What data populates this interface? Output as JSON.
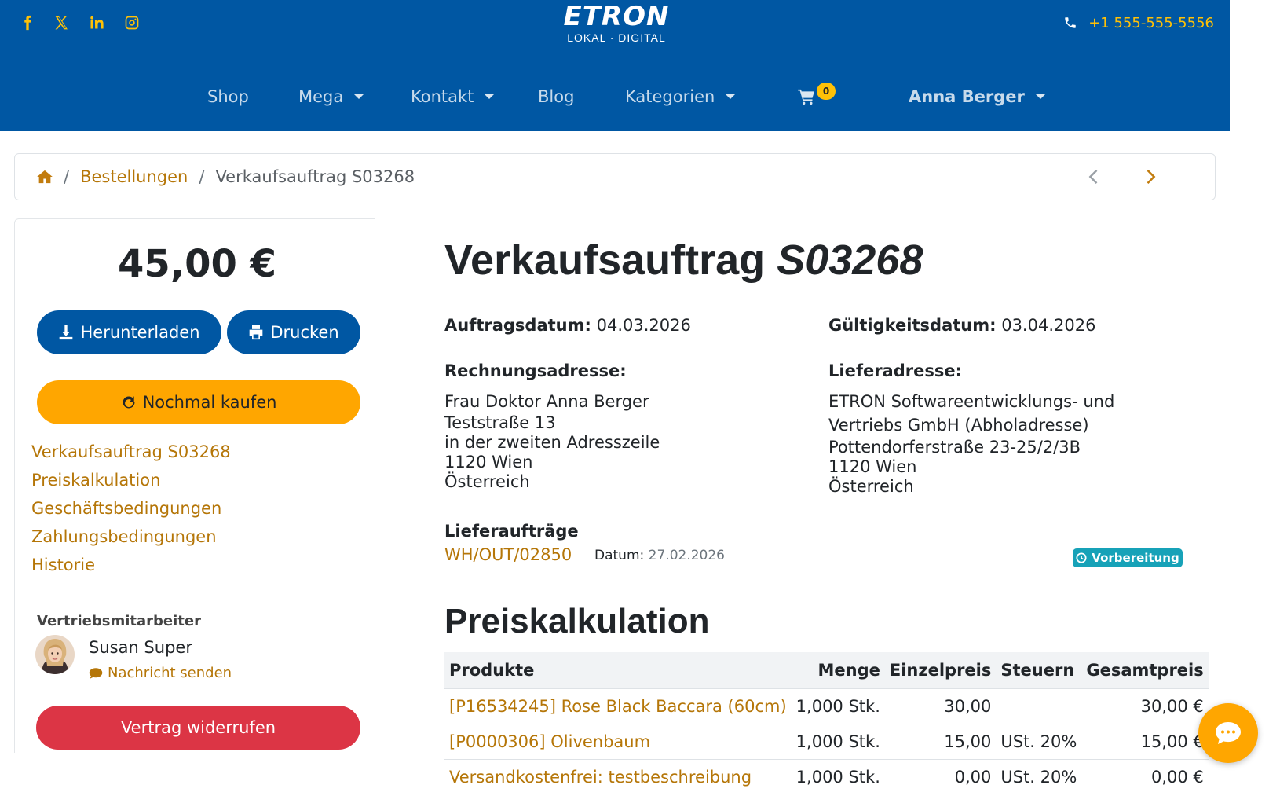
{
  "header": {
    "social": [
      {
        "icon": "facebook-icon"
      },
      {
        "icon": "x-twitter-icon"
      },
      {
        "icon": "linkedin-icon"
      },
      {
        "icon": "instagram-icon"
      }
    ],
    "logo": {
      "main": "ETRON",
      "sub": "LOKAL · DIGITAL"
    },
    "phone": "+1 555-555-5556",
    "nav": {
      "shop": "Shop",
      "mega": "Mega",
      "contact": "Kontakt",
      "blog": "Blog",
      "categories": "Kategorien",
      "cart_count": "0",
      "user": "Anna Berger"
    },
    "colors": {
      "brand": "#0057a3",
      "accent": "#ffc107"
    }
  },
  "breadcrumb": {
    "home_icon": "home-icon",
    "orders": "Bestellungen",
    "current": "Verkaufsauftrag S03268"
  },
  "sidebar": {
    "total": "45,00 €",
    "download_label": "Herunterladen",
    "print_label": "Drucken",
    "reorder_label": "Nochmal kaufen",
    "links": [
      "Verkaufsauftrag S03268",
      "Preiskalkulation",
      "Geschäftsbedingungen",
      "Zahlungsbedingungen",
      "Historie"
    ],
    "salesperson_title": "Vertriebsmitarbeiter",
    "salesperson_name": "Susan Super",
    "send_message": "Nachricht senden",
    "cancel_label": "Vertrag widerrufen"
  },
  "order": {
    "title_prefix": "Verkaufsauftrag",
    "title_ref": "S03268",
    "order_date_label": "Auftragsdatum:",
    "order_date": "04.03.2026",
    "validity_label": "Gültigkeitsdatum:",
    "validity_date": "03.04.2026",
    "invoice_label": "Rechnungsadresse:",
    "invoice_lines": [
      "Frau Doktor Anna Berger",
      "Teststraße 13",
      "in der zweiten Adresszeile",
      "1120 Wien",
      "Österreich"
    ],
    "delivery_label": "Lieferadresse:",
    "delivery_lines": [
      "ETRON Softwareentwicklungs- und",
      "Vertriebs GmbH (Abholadresse)",
      "Pottendorferstraße 23-25/2/3B",
      "1120 Wien",
      "Österreich"
    ],
    "delivery_orders_label": "Lieferaufträge",
    "delivery_ref": "WH/OUT/02850",
    "delivery_date_label": "Datum:",
    "delivery_date": "27.02.2026",
    "delivery_status": "Vorbereitung"
  },
  "pricing": {
    "title": "Preiskalkulation",
    "columns": [
      "Produkte",
      "Menge",
      "Einzelpreis",
      "Steuern",
      "Gesamtpreis"
    ],
    "rows": [
      {
        "product": "[P16534245] Rose Black Baccara (60cm)",
        "qty": "1,000 Stk.",
        "unit": "30,00",
        "tax": "",
        "total": "30,00 €"
      },
      {
        "product": "[P0000306] Olivenbaum",
        "qty": "1,000 Stk.",
        "unit": "15,00",
        "tax": "USt. 20%",
        "total": "15,00 €"
      },
      {
        "product": "Versandkostenfrei: testbeschreibung",
        "qty": "1,000 Stk.",
        "unit": "0,00",
        "tax": "USt. 20%",
        "total": "0,00 €"
      }
    ]
  },
  "chat": {
    "icon": "chat-icon"
  }
}
